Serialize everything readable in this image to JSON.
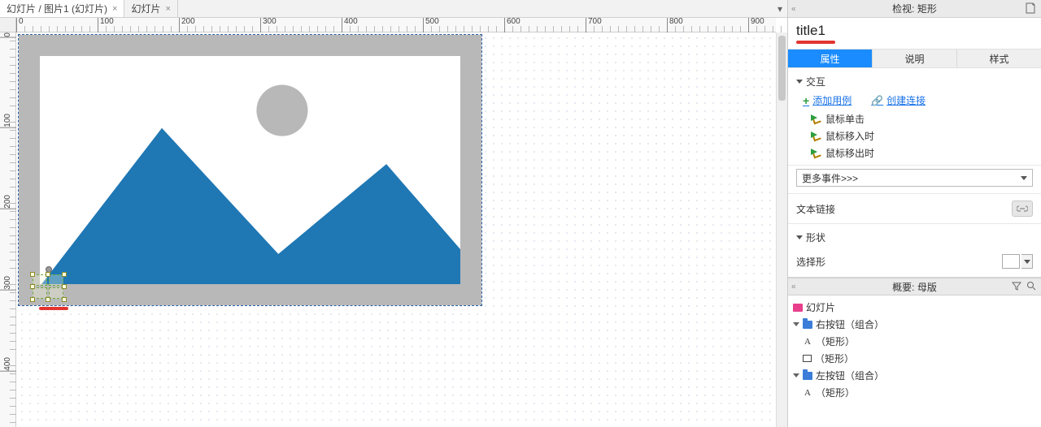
{
  "tabs": {
    "active": "幻灯片 / 图片1 (幻灯片)",
    "inactive": "幻灯片"
  },
  "ruler_h": [
    "0",
    "100",
    "200",
    "300",
    "400",
    "500",
    "600",
    "700",
    "800",
    "900"
  ],
  "ruler_v": [
    "0",
    "100",
    "200",
    "300",
    "400"
  ],
  "inspector": {
    "header": "检视: 矩形",
    "name": "title1",
    "tabs": {
      "props": "属性",
      "notes": "说明",
      "style": "样式"
    },
    "interaction": {
      "title": "交互",
      "add_case": "添加用例",
      "create_link": "创建连接",
      "events": [
        "鼠标单击",
        "鼠标移入时",
        "鼠标移出时"
      ],
      "more": "更多事件>>>"
    },
    "textlink": "文本链接",
    "shape": {
      "title": "形状",
      "select_label": "选择形"
    }
  },
  "outline": {
    "header": "概要: 母版",
    "nodes": {
      "page": "幻灯片",
      "group_right": "右按钮（组合）",
      "rect1": "（矩形）",
      "rect2": "（矩形）",
      "group_left": "左按钮（组合）",
      "rect3": "（矩形）"
    }
  }
}
